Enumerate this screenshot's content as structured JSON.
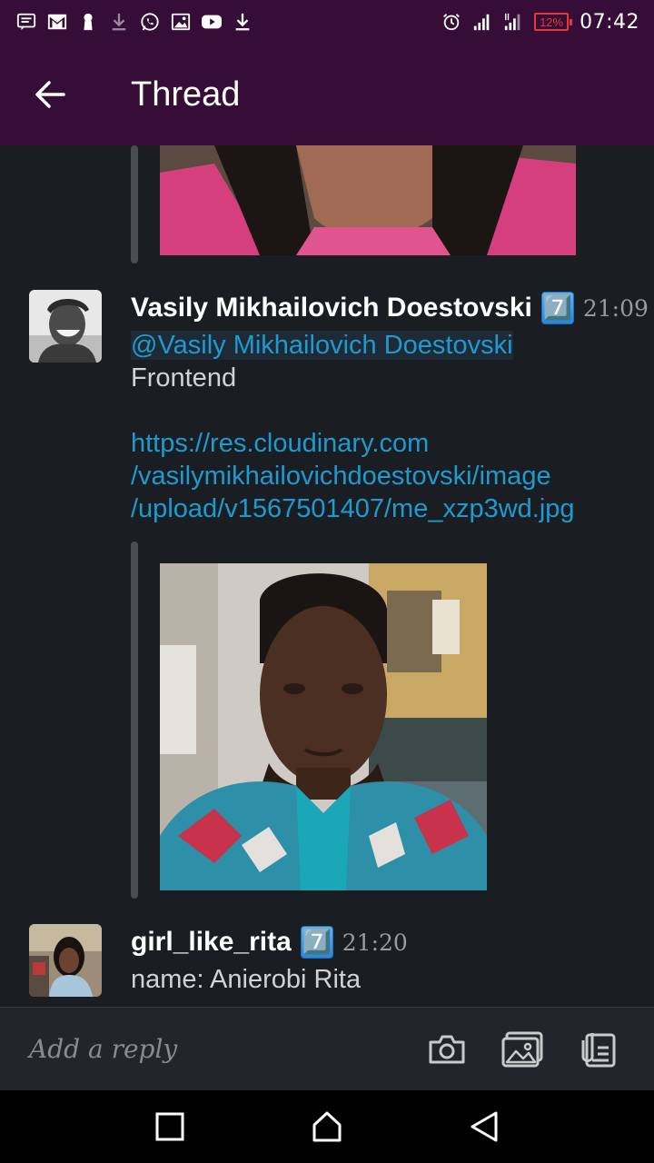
{
  "status_bar": {
    "time": "07:42",
    "battery": "12%",
    "icons": [
      "message-icon",
      "gmail-icon",
      "keyhole-icon",
      "download-icon",
      "whatsapp-icon",
      "image-icon",
      "youtube-icon",
      "download-icon",
      "alarm-icon",
      "signal-icon",
      "signal-icon",
      "battery-icon"
    ]
  },
  "app_bar": {
    "title": "Thread",
    "back_icon": "arrow-left-icon"
  },
  "messages": [
    {
      "author": "Vasily Mikhailovich Doestovski",
      "badge": "7️⃣",
      "time": "21:09",
      "mention": "@Vasily Mikhailovich Doestovski",
      "lines": [
        "Frontend"
      ],
      "link_lines": [
        "https://res.cloudinary.com",
        "/vasilymikhailovichdoestovski/image",
        "/upload/v1567501407/me_xzp3wd.jpg"
      ]
    },
    {
      "author": "girl_like_rita",
      "badge": "7️⃣",
      "time": "21:20",
      "lines": [
        "name: Anierobi Rita"
      ]
    }
  ],
  "composer": {
    "placeholder": "Add a reply",
    "icons": [
      "camera-icon",
      "gallery-icon",
      "files-icon"
    ]
  },
  "nav_bar": {
    "icons": [
      "recents-icon",
      "home-icon",
      "back-icon"
    ]
  },
  "colors": {
    "header": "#350d36",
    "background": "#1a1d21",
    "link": "#1d9bd1",
    "battery_low": "#e53935"
  }
}
